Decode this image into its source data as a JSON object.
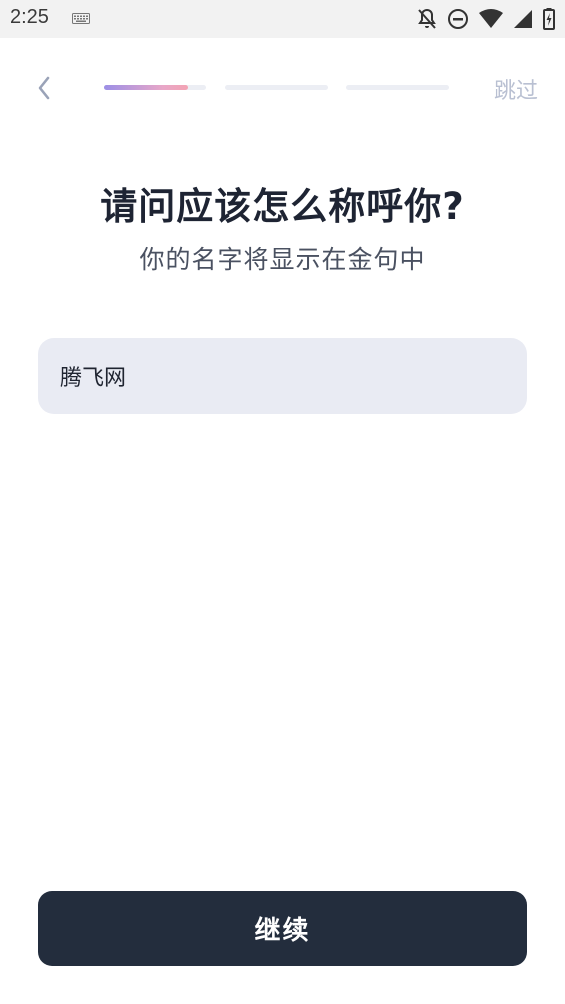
{
  "status_bar": {
    "time": "2:25",
    "icons": [
      "keyboard-icon",
      "notifications-off-icon",
      "do-not-disturb-icon",
      "wifi-icon",
      "cell-signal-icon",
      "battery-charging-icon"
    ]
  },
  "nav": {
    "back_icon": "chevron-left-icon",
    "skip_label": "跳过",
    "steps_total": 3,
    "current_step": 1,
    "current_step_fill": 0.82
  },
  "content": {
    "title": "请问应该怎么称呼你?",
    "subtitle": "你的名字将显示在金句中",
    "name_value": "腾飞网"
  },
  "footer": {
    "continue_label": "继续"
  },
  "colors": {
    "primary_button": "#232d3d",
    "input_bg": "#e9ebf3",
    "progress_gradient_start": "#9c8fe6",
    "progress_gradient_end": "#f3a3b3",
    "muted_text": "#b9c0d2"
  }
}
